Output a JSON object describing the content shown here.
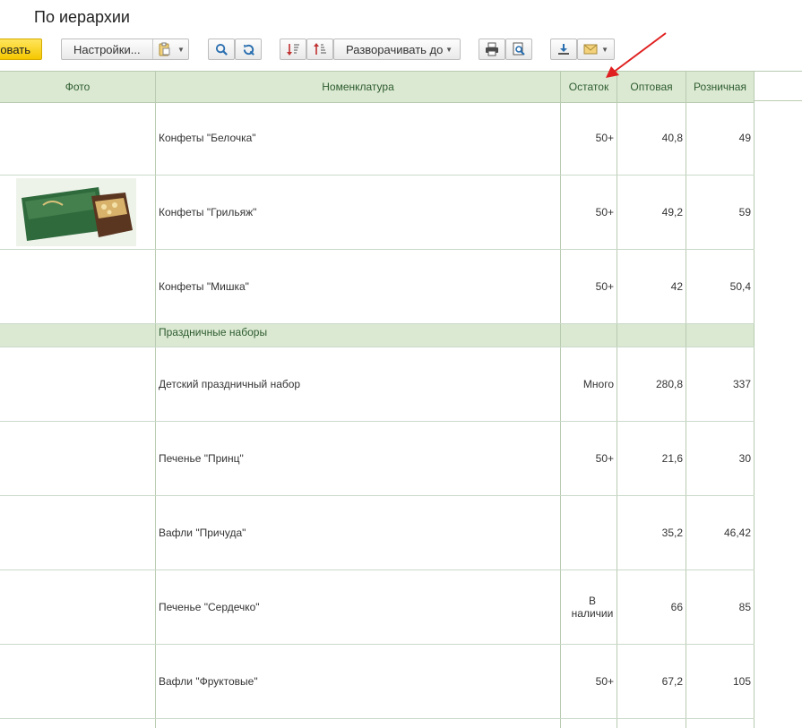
{
  "title": "По иерархии",
  "toolbar": {
    "primary_label": "овать",
    "settings_label": "Настройки...",
    "expand_label": "Разворачивать до"
  },
  "columns": [
    "Фото",
    "Номенклатура",
    "Остаток",
    "Оптовая",
    "Розничная"
  ],
  "rows": [
    {
      "name": "Конфеты \"Белочка\"",
      "stock": "50+",
      "wholesale": "40,8",
      "retail": "49",
      "photo": false
    },
    {
      "name": "Конфеты \"Грильяж\"",
      "stock": "50+",
      "wholesale": "49,2",
      "retail": "59",
      "photo": true
    },
    {
      "name": "Конфеты \"Мишка\"",
      "stock": "50+",
      "wholesale": "42",
      "retail": "50,4",
      "photo": false
    },
    {
      "group": true,
      "name": "Праздничные наборы"
    },
    {
      "name": "Детский праздничный набор",
      "stock": "Много",
      "wholesale": "280,8",
      "retail": "337",
      "photo": false
    },
    {
      "name": "Печенье \"Принц\"",
      "stock": "50+",
      "wholesale": "21,6",
      "retail": "30",
      "photo": false
    },
    {
      "name": "Вафли \"Причуда\"",
      "stock": "",
      "wholesale": "35,2",
      "retail": "46,42",
      "photo": false
    },
    {
      "name": "Печенье \"Сердечко\"",
      "stock": "В наличии",
      "wholesale": "66",
      "retail": "85",
      "photo": false
    },
    {
      "name": "Вафли \"Фруктовые\"",
      "stock": "50+",
      "wholesale": "67,2",
      "retail": "105",
      "photo": false
    }
  ],
  "colors": {
    "header_bg": "#dbe9d3",
    "primary_button": "#f5c800",
    "annotation_arrow": "#e02020"
  },
  "icons": [
    "clipboard-icon",
    "search-icon",
    "refresh-search-icon",
    "sort-ascending-icon",
    "sort-descending-icon",
    "print-icon",
    "print-preview-icon",
    "download-icon",
    "email-icon"
  ]
}
